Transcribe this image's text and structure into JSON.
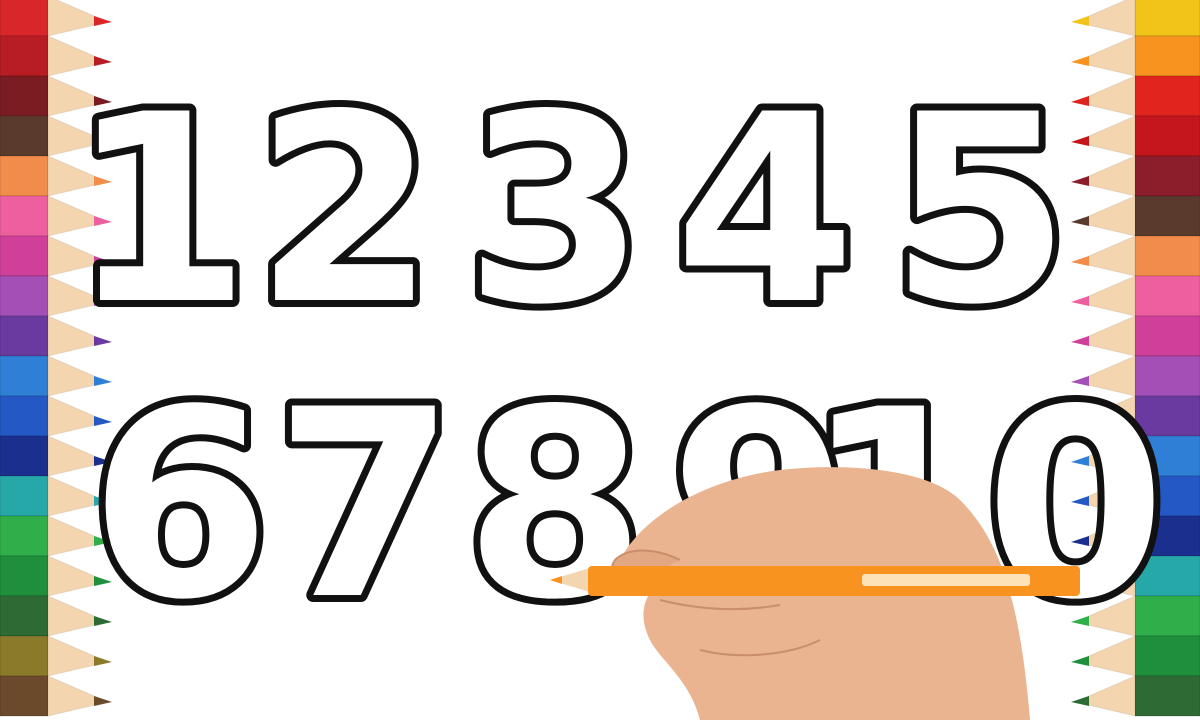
{
  "numbers": {
    "row1": [
      "1",
      "2",
      "3",
      "4",
      "5"
    ],
    "row2": [
      "6",
      "7",
      "8",
      "9",
      "10"
    ]
  },
  "colors": {
    "background": "#ffffff",
    "outline": "#111111",
    "held_pencil": "#f7931e",
    "skin": "#e9b48f",
    "wood": "#f3d6b0",
    "pencils_left": [
      "#d8262b",
      "#b81d24",
      "#7a1c22",
      "#5b3a2e",
      "#f28c4b",
      "#ee5fa0",
      "#d0409a",
      "#a34fb5",
      "#6a3aa0",
      "#2f7fd6",
      "#2458c4",
      "#1b2f8f",
      "#27a8a8",
      "#2fae4a",
      "#1f8f3c",
      "#2e6b34",
      "#8a7a2a",
      "#6b4a2b"
    ],
    "pencils_right": [
      "#f2c41a",
      "#f7931e",
      "#e0251f",
      "#c4161c",
      "#8c1d2a",
      "#5b3a2e",
      "#f28c4b",
      "#ee5fa0",
      "#d0409a",
      "#a34fb5",
      "#6a3aa0",
      "#2f7fd6",
      "#2458c4",
      "#1b2f8f",
      "#27a8a8",
      "#2fae4a",
      "#1f8f3c",
      "#2e6b34"
    ]
  },
  "icons": [
    "colored-pencil-icon",
    "hand-icon"
  ]
}
